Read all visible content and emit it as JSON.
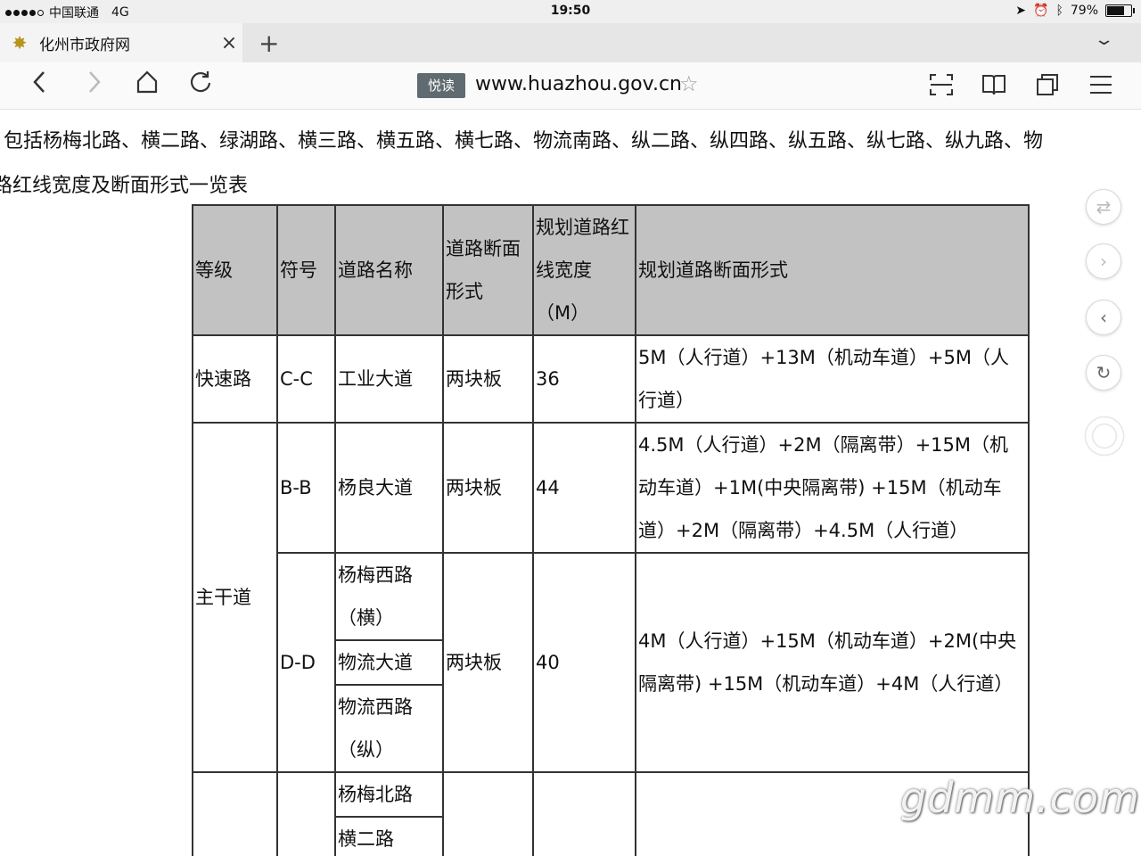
{
  "status_bar": {
    "carrier": "中国联通",
    "network": "4G",
    "time": "19:50",
    "battery": "79%",
    "battery_level": 0.79
  },
  "tab": {
    "title": "化州市政府网",
    "close_label": "×",
    "new_tab_label": "+"
  },
  "address_bar": {
    "read_mode_label": "悦读",
    "url": "www.huazhou.gov.cn"
  },
  "content": {
    "intro_text": "包括杨梅北路、横二路、绿湖路、横三路、横五路、横七路、物流南路、纵二路、纵四路、纵五路、纵七路、纵九路、物",
    "caption": "路红线宽度及断面形式一览表"
  },
  "table": {
    "headers": {
      "grade": "等级",
      "symbol": "符号",
      "road_name": "道路名称",
      "section_type": "道路断面形式",
      "width": "规划道路红线宽度（M）",
      "section_form": "规划道路断面形式"
    },
    "rows": {
      "r1": {
        "grade": "快速路",
        "symbol": "C-C",
        "road": "工业大道",
        "section": "两块板",
        "width": "36",
        "form": "5M（人行道）+13M（机动车道）+5M（人行道）"
      },
      "r2": {
        "grade": "主干道",
        "symbol": "B-B",
        "road": "杨良大道",
        "section": "两块板",
        "width": "44",
        "form": "4.5M（人行道）+2M（隔离带）+15M（机动车道）+1M(中央隔离带) +15M（机动车道）+2M（隔离带）+4.5M（人行道）"
      },
      "r3": {
        "symbol": "D-D",
        "road_a": "杨梅西路（横）",
        "road_b": "物流大道",
        "road_c": "物流西路（纵）",
        "section": "两块板",
        "width": "40",
        "form": "4M（人行道）+15M（机动车道）+2M(中央隔离带) +15M（机动车道）+4M（人行道）"
      },
      "r4": {
        "road_a": "杨梅北路",
        "road_b": "横二路"
      }
    }
  },
  "watermark": "gdmm.com"
}
